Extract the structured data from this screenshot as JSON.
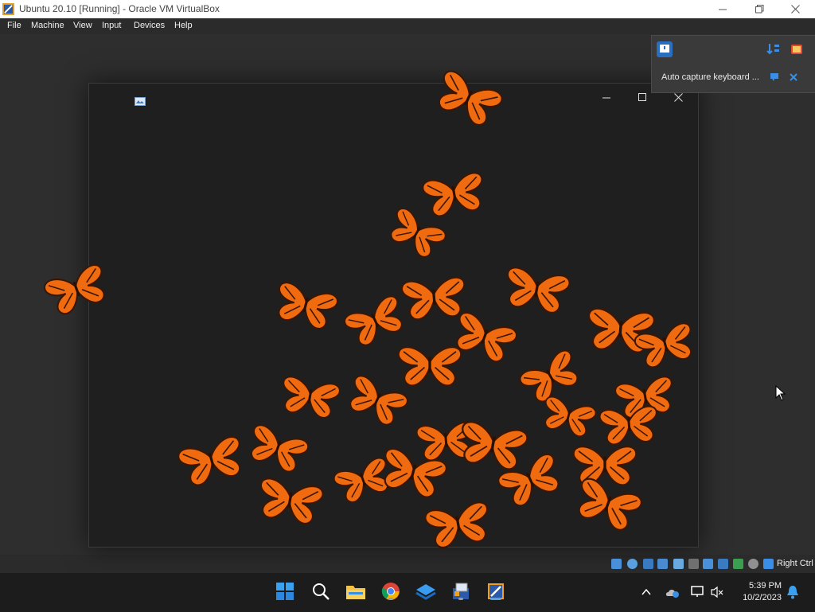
{
  "window": {
    "title": "Ubuntu 20.10 [Running] - Oracle VM VirtualBox",
    "controls": [
      "minimize",
      "maximize",
      "close"
    ]
  },
  "menubar": {
    "items": [
      "File",
      "Machine",
      "View",
      "Input",
      "Devices",
      "Help"
    ]
  },
  "notification": {
    "message": "Auto capture keyboard ..."
  },
  "statusbar": {
    "host_key": "Right Ctrl"
  },
  "taskbar": {
    "apps": [
      "start-icon",
      "search-icon",
      "file-explorer-icon",
      "chrome-icon",
      "azure-data-studio-icon",
      "virtualbox-icon",
      "virtualbox-vm-icon"
    ],
    "clock_time": "5:39 PM",
    "clock_date": "10/2/2023"
  },
  "colors": {
    "butterfly_orange": "#f06a10",
    "butterfly_dark": "#3a1605",
    "accent_blue": "#3a8ee6",
    "desktop_bg": "#2e2e2e"
  }
}
